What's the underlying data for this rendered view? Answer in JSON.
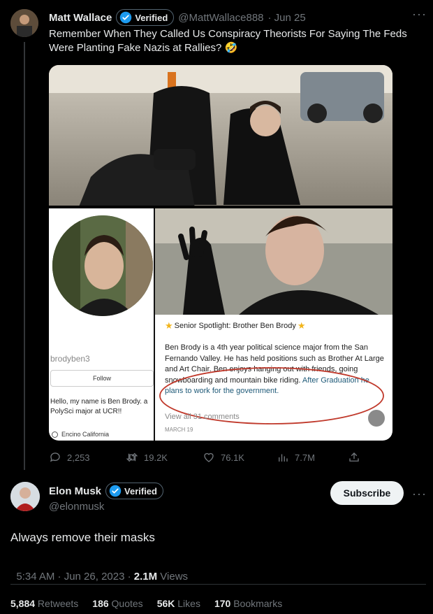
{
  "quoted_tweet": {
    "author_name": "Matt Wallace",
    "verified_label": "Verified",
    "handle": "@MattWallace888",
    "date": "· Jun 25",
    "text": "Remember When They Called Us Conspiracy Theorists For Saying The Feds Were Planting Fake Nazis at Rallies? 🤣",
    "media": {
      "profile_username": "brodyben3",
      "follow_label": "Follow",
      "bio": "Hello, my name is Ben Brody. a PolySci major at UCR!!",
      "location": "Encino California",
      "spotlight_title": "Senior Spotlight: Brother Ben Brody",
      "spotlight_body": "Ben Brody is a 4th year political science major from the San Fernando Valley. He has held positions such as Brother At Large and Art Chair. Ben enjoys hanging out with friends, going snowboarding and mountain bike riding.",
      "spotlight_highlight": "After Graduation he plans to work for the government.",
      "comments_link": "View all 31 comments",
      "post_date": "MARCH 19"
    },
    "actions": {
      "replies": "2,253",
      "retweets": "19.2K",
      "likes": "76.1K",
      "views": "7.7M"
    }
  },
  "main_tweet": {
    "author_name": "Elon Musk",
    "verified_label": "Verified",
    "handle": "@elonmusk",
    "subscribe_label": "Subscribe",
    "text": "Always remove their masks",
    "timestamp": "5:34 AM · Jun 26, 2023 · ",
    "views_count": "2.1M",
    "views_label": " Views",
    "stats": {
      "retweets_count": "5,884",
      "retweets_label": " Retweets",
      "quotes_count": "186",
      "quotes_label": " Quotes",
      "likes_count": "56K",
      "likes_label": " Likes",
      "bookmarks_count": "170",
      "bookmarks_label": " Bookmarks"
    }
  },
  "colors": {
    "accent": "#1d9bf0",
    "background": "#000000",
    "muted": "#71767b"
  }
}
